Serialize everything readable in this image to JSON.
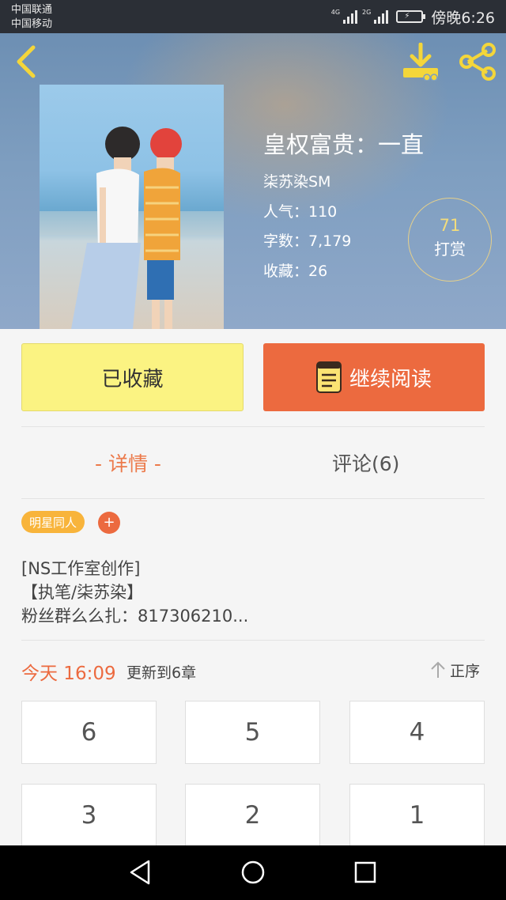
{
  "status_bar": {
    "carrier1": "中国联通",
    "carrier2": "中国移动",
    "sig1_tag": "4G",
    "sig2_tag": "2G",
    "time": "傍晚6:26"
  },
  "header": {
    "title": "皇权富贵：一直",
    "author": "柒苏染SM",
    "popularity": "人气：110",
    "word_count": "字数：7,179",
    "favorites": "收藏：26",
    "reward_count": "71",
    "reward_label": "打赏",
    "icons": [
      "back-arrow",
      "download",
      "share"
    ],
    "accent": "#f2dc7c"
  },
  "actions": {
    "favorited_label": "已收藏",
    "continue_label": "继续阅读",
    "continue_color": "#ec6a3f",
    "favorited_color": "#fbf382"
  },
  "tabs": {
    "details": "- 详情 -",
    "comments": "评论(6)"
  },
  "tags": {
    "tag1": "明星同人",
    "add": "+"
  },
  "description": {
    "line1": "[NS工作室创作]",
    "line2": "【执笔/柒苏染】",
    "line3": "粉丝群么么扎：817306210..."
  },
  "update": {
    "time": "今天 16:09",
    "text": "更新到6章",
    "sort_label": "正序"
  },
  "chapters": [
    "6",
    "5",
    "4",
    "3",
    "2",
    "1"
  ],
  "navbar": {
    "icons": [
      "back-triangle",
      "home-circle",
      "recents-square"
    ]
  }
}
